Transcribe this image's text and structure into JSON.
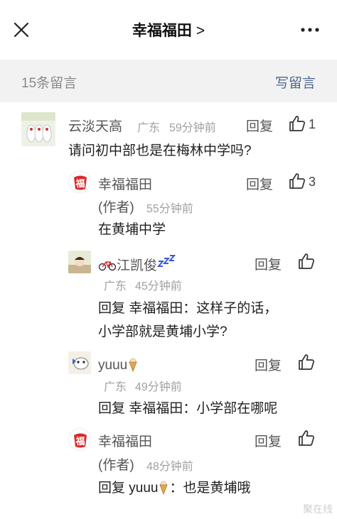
{
  "header": {
    "title": "幸福福田",
    "chevron": ">"
  },
  "subheader": {
    "count": "15条留言",
    "write": "写留言"
  },
  "comments": [
    {
      "name": "云淡天高",
      "location": "广东",
      "time": "59分钟前",
      "reply": "回复",
      "likes": "1",
      "text": "请问初中部也是在梅林中学吗?"
    },
    {
      "name": "幸福福田",
      "author_tag": "(作者)",
      "time": "55分钟前",
      "reply": "回复",
      "likes": "3",
      "text": "在黄埔中学"
    },
    {
      "name": "江凯俊",
      "location": "广东",
      "time": "45分钟前",
      "reply": "回复",
      "text_line1": "回复 幸福福田：这样子的话，",
      "text_line2": "小学部就是黄埔小学?"
    },
    {
      "name": "yuuu",
      "location": "广东",
      "time": "49分钟前",
      "reply": "回复",
      "text": "回复 幸福福田：小学部在哪呢"
    },
    {
      "name": "幸福福田",
      "author_tag": "(作者)",
      "time": "48分钟前",
      "reply": "回复",
      "text_prefix": "回复 yuuu",
      "text_suffix": "：也是黄埔哦"
    }
  ],
  "watermark": "聚在线"
}
